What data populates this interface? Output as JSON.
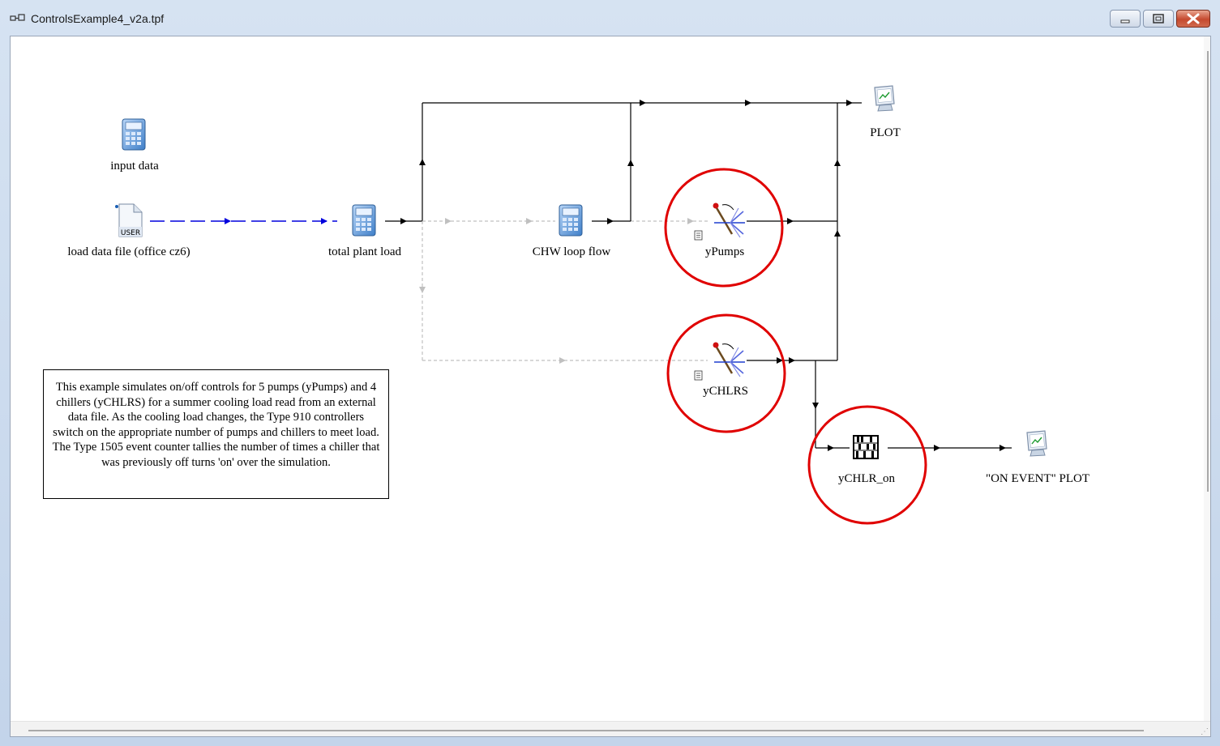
{
  "window": {
    "title": "ControlsExample4_v2a.tpf",
    "controls": {
      "minimize": "minimize",
      "maximize": "maximize",
      "close": "close"
    }
  },
  "components": {
    "input_data": {
      "label": "input data",
      "icon": "calculator-icon"
    },
    "load_file": {
      "label": "load data file (office cz6)",
      "icon": "user-file-icon",
      "badge": "USER"
    },
    "total_plant_load": {
      "label": "total plant load",
      "icon": "calculator-icon"
    },
    "chw_loop_flow": {
      "label": "CHW loop flow",
      "icon": "calculator-icon"
    },
    "ypumps": {
      "label": "yPumps",
      "icon": "controller-icon"
    },
    "ychlrs": {
      "label": "yCHLRS",
      "icon": "controller-icon"
    },
    "ychlr_on": {
      "label": "yCHLR_on",
      "icon": "abacus-counter-icon"
    },
    "plot": {
      "label": "PLOT",
      "icon": "monitor-plot-icon"
    },
    "on_event_plot": {
      "label": "\"ON EVENT\" PLOT",
      "icon": "monitor-plot-icon"
    }
  },
  "note": {
    "text": "This example simulates on/off controls for 5 pumps (yPumps) and 4 chillers (yCHLRS) for a summer cooling load read from an external data file. As the cooling load changes, the Type 910 controllers switch on the appropriate number of pumps and chillers to meet load. The Type 1505 event counter tallies the number of times a chiller that was previously off turns 'on' over the simulation."
  },
  "colors": {
    "highlight_circle": "#e00000",
    "data_link": "#0000dd",
    "inactive_link": "#c0c0c0",
    "link": "#000000"
  }
}
